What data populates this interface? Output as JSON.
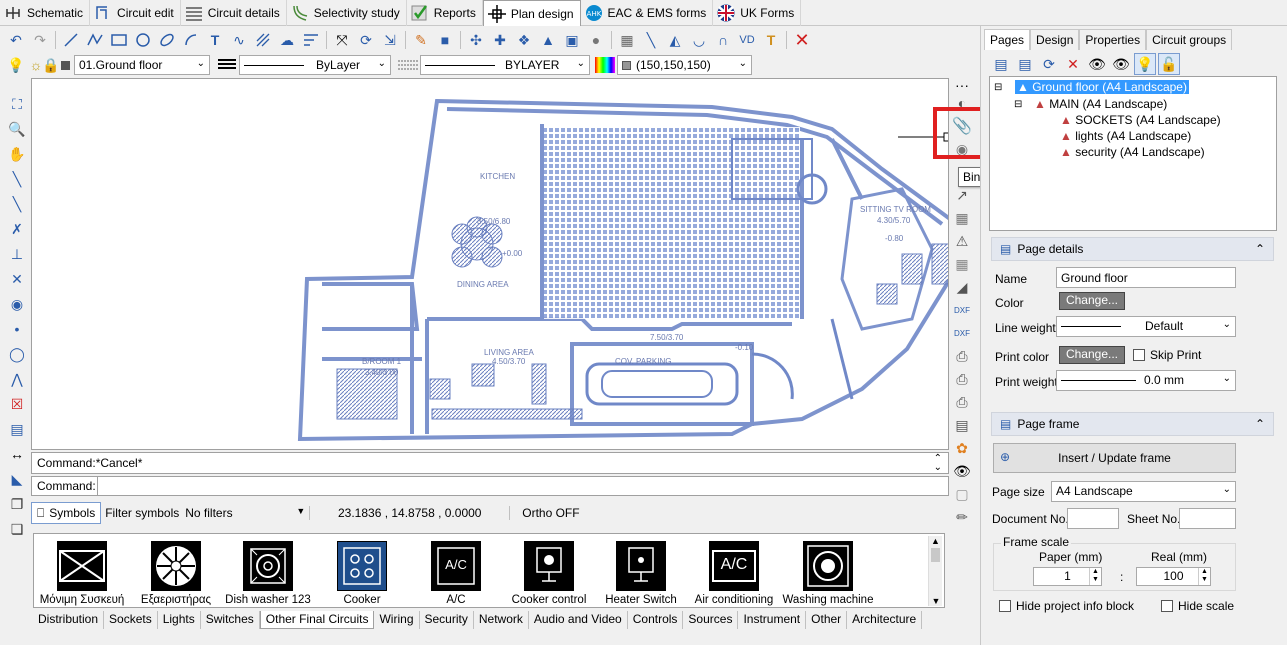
{
  "tabs": [
    {
      "label": "Schematic",
      "icon": "schematic-icon"
    },
    {
      "label": "Circuit edit",
      "icon": "circuit-edit-icon"
    },
    {
      "label": "Circuit details",
      "icon": "list-icon"
    },
    {
      "label": "Selectivity study",
      "icon": "curve-icon"
    },
    {
      "label": "Reports",
      "icon": "check-icon"
    },
    {
      "label": "Plan design",
      "icon": "crosshair-icon"
    },
    {
      "label": "EAC & EMS forms",
      "icon": "eac-logo-icon"
    },
    {
      "label": "UK Forms",
      "icon": "uk-flag-icon"
    }
  ],
  "props": {
    "layer": "01.Ground floor",
    "linetype": "ByLayer",
    "lineweight": "BYLAYER",
    "color": "(150,150,150)"
  },
  "floorplan": {
    "rooms": [
      "KITCHEN",
      "DINING AREA",
      "LIVING AREA",
      "B/ROOM 1",
      "COV. PARKING",
      "SITTING TV ROOM"
    ],
    "dims": [
      "3.50/6.80",
      "+0.00",
      "4.50/3.70",
      "3.40/3.00",
      "7.50/3.70",
      "-0.10",
      "4.30/5.70",
      "-0.80"
    ]
  },
  "tooltip": "Bind Xref",
  "command": {
    "history": "Command:*Cancel*",
    "prompt": "Command:",
    "value": ""
  },
  "status": {
    "symbols": "Symbols",
    "filter_label": "Filter symbols",
    "filter_value": "No filters",
    "coords": "23.1836 , 14.8758 , 0.0000",
    "ortho": "Ortho OFF"
  },
  "symbols": [
    {
      "label": "Μόνιμη Συσκευή",
      "icon": "permanent-appliance-icon"
    },
    {
      "label": "Εξαεριστήρας",
      "icon": "fan-icon"
    },
    {
      "label": "Dish washer 123",
      "icon": "dishwasher-icon"
    },
    {
      "label": "Cooker",
      "icon": "cooker-icon"
    },
    {
      "label": "A/C",
      "icon": "ac-icon"
    },
    {
      "label": "Cooker control",
      "icon": "cooker-control-icon"
    },
    {
      "label": "Heater Switch",
      "icon": "heater-switch-icon"
    },
    {
      "label": "Air conditioning",
      "icon": "air-conditioning-icon"
    },
    {
      "label": "Washing machine",
      "icon": "washing-machine-icon"
    }
  ],
  "symbol_box_text": {
    "ac": "A/C",
    "aircon": "A/C"
  },
  "categories": [
    "Distribution",
    "Sockets",
    "Lights",
    "Switches",
    "Other Final Circuits",
    "Wiring",
    "Security",
    "Network",
    "Audio and Video",
    "Controls",
    "Sources",
    "Instrument",
    "Other",
    "Architecture"
  ],
  "right": {
    "tabs": [
      "Pages",
      "Design",
      "Properties",
      "Circuit groups"
    ],
    "tree": {
      "root": "Ground floor (A4 Landscape)",
      "child": "MAIN (A4 Landscape)",
      "leaves": [
        "SOCKETS (A4 Landscape)",
        "lights (A4 Landscape)",
        "security (A4 Landscape)"
      ]
    },
    "page_details": {
      "title": "Page details",
      "name_label": "Name",
      "name_value": "Ground floor",
      "color_label": "Color",
      "change_label": "Change...",
      "lineweight_label": "Line weight",
      "lineweight_value": "Default",
      "printcolor_label": "Print color",
      "skip_print": "Skip Print",
      "printweight_label": "Print weight",
      "printweight_value": "0.0 mm"
    },
    "page_frame": {
      "title": "Page frame",
      "insert_label": "Insert / Update frame",
      "pagesize_label": "Page size",
      "pagesize_value": "A4 Landscape",
      "docno_label": "Document No.",
      "sheetno_label": "Sheet No.",
      "scale_label": "Frame scale",
      "paper_label": "Paper (mm)",
      "real_label": "Real (mm)",
      "paper_value": "1",
      "real_value": "100",
      "colon": ":",
      "hide_info": "Hide project info block",
      "hide_scale": "Hide scale"
    }
  },
  "colors": {
    "accent": "#2a5caa",
    "highlight": "#e02020",
    "plan": "#7088c8",
    "selection": "#3399ff"
  }
}
